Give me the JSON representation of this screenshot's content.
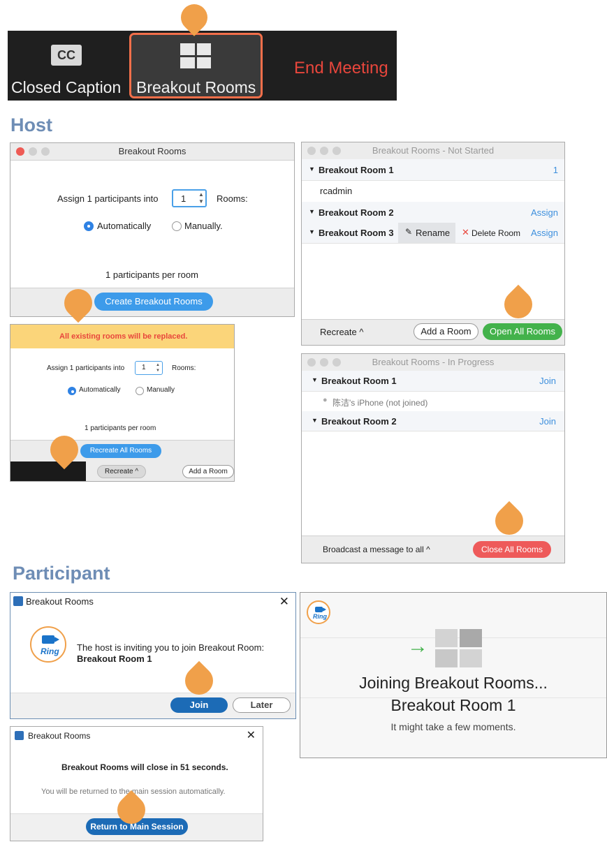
{
  "toolbar": {
    "closed_caption_label": "Closed Caption",
    "cc_text": "CC",
    "breakout_rooms_label": "Breakout Rooms",
    "end_meeting_label": "End Meeting"
  },
  "sections": {
    "host": "Host",
    "participant": "Participant"
  },
  "create_dialog": {
    "title": "Breakout Rooms",
    "assign_prefix": "Assign 1 participants into",
    "rooms_value": "1",
    "rooms_suffix": "Rooms:",
    "option_auto": "Automatically",
    "option_manual": "Manually.",
    "per_room": "1 participants per room",
    "create_button": "Create Breakout Rooms"
  },
  "recreate_dialog": {
    "warning": "All existing rooms will be replaced.",
    "assign_prefix": "Assign 1 participants into",
    "rooms_value": "1",
    "rooms_suffix": "Rooms:",
    "option_auto": "Automatically",
    "option_manual": "Manually",
    "per_room": "1 participants per room",
    "recreate_all_button": "Recreate All Rooms",
    "recreate_button": "Recreate ^",
    "add_room_button": "Add a Room"
  },
  "not_started": {
    "title": "Breakout Rooms - Not Started",
    "room1": "Breakout Room 1",
    "room1_count": "1",
    "room1_member": "rcadmin",
    "room2": "Breakout Room 2",
    "room2_action": "Assign",
    "room3": "Breakout Room 3",
    "rename": "Rename",
    "delete_room": "Delete Room",
    "room3_action": "Assign",
    "recreate": "Recreate ^",
    "add_room": "Add a Room",
    "open_all": "Open All Rooms"
  },
  "in_progress": {
    "title": "Breakout Rooms - In Progress",
    "room1": "Breakout Room 1",
    "room1_action": "Join",
    "room1_member": "陈洁's iPhone (not joined)",
    "room2": "Breakout Room 2",
    "room2_action": "Join",
    "broadcast": "Broadcast a message to all ^",
    "close_all": "Close All Rooms"
  },
  "invite_dialog": {
    "title": "Breakout Rooms",
    "message": "The host is inviting you to join Breakout Room:",
    "room": "Breakout Room 1",
    "join_button": "Join",
    "later_button": "Later",
    "logo_text": "Ring"
  },
  "closing_dialog": {
    "title": "Breakout Rooms",
    "message": "Breakout Rooms will close in 51 seconds.",
    "sub": "You will be returned to the main session automatically.",
    "return_button": "Return to Main Session"
  },
  "joining_panel": {
    "heading": "Joining Breakout Rooms...",
    "room": "Breakout Room 1",
    "sub": "It might take a few moments.",
    "logo_text": "Ring"
  },
  "colors": {
    "accent_blue": "#3d9bea",
    "open_green": "#43b24b",
    "close_red": "#ee5a5a",
    "pin_orange": "#f0a04a",
    "end_red": "#e8463c"
  }
}
